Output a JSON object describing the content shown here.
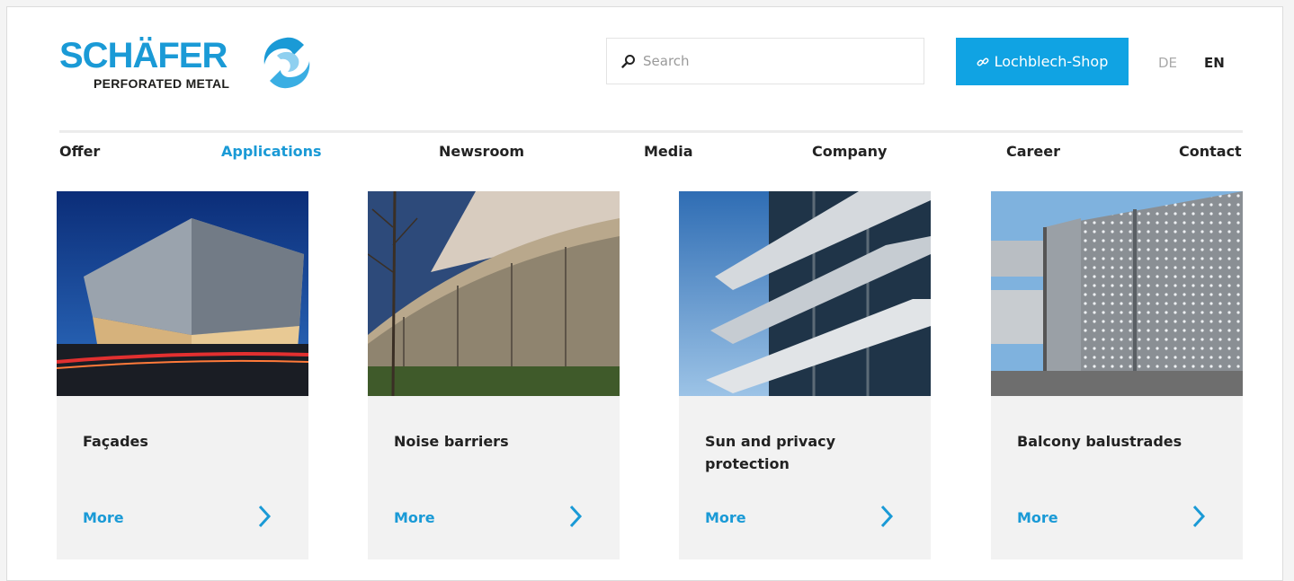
{
  "brand": {
    "name": "SCHÄFER",
    "tagline": "PERFORATED METAL",
    "color": "#1a9ad6"
  },
  "search": {
    "placeholder": "Search",
    "value": ""
  },
  "shop_button": {
    "label": "Lochblech-Shop",
    "color": "#10a3e3"
  },
  "languages": {
    "de": "DE",
    "en": "EN",
    "active": "EN"
  },
  "nav": {
    "items": [
      {
        "label": "Offer"
      },
      {
        "label": "Applications",
        "active": true
      },
      {
        "label": "Newsroom"
      },
      {
        "label": "Media"
      },
      {
        "label": "Company"
      },
      {
        "label": "Career"
      },
      {
        "label": "Contact"
      }
    ]
  },
  "cards": [
    {
      "title": "Façades",
      "more": "More"
    },
    {
      "title": "Noise barriers",
      "more": "More"
    },
    {
      "title": "Sun and privacy protection",
      "more": "More"
    },
    {
      "title": "Balcony balustrades",
      "more": "More"
    }
  ]
}
